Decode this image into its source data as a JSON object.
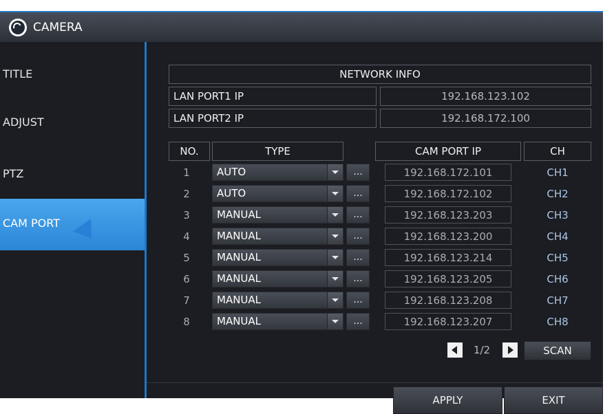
{
  "window": {
    "title": "CAMERA"
  },
  "sidebar": {
    "items": [
      {
        "label": "TITLE",
        "active": false
      },
      {
        "label": "ADJUST",
        "active": false
      },
      {
        "label": "PTZ",
        "active": false
      },
      {
        "label": "CAM PORT",
        "active": true
      }
    ]
  },
  "network": {
    "header": "NETWORK INFO",
    "lan1_label": "LAN PORT1 IP",
    "lan1_value": "192.168.123.102",
    "lan2_label": "LAN PORT2 IP",
    "lan2_value": "192.168.172.100"
  },
  "table": {
    "headers": {
      "no": "NO.",
      "type": "TYPE",
      "ip": "CAM PORT IP",
      "ch": "CH"
    },
    "rows": [
      {
        "no": "1",
        "type": "AUTO",
        "dots": "...",
        "ip": "192.168.172.101",
        "ch": "CH1"
      },
      {
        "no": "2",
        "type": "AUTO",
        "dots": "...",
        "ip": "192.168.172.102",
        "ch": "CH2"
      },
      {
        "no": "3",
        "type": "MANUAL",
        "dots": "...",
        "ip": "192.168.123.203",
        "ch": "CH3"
      },
      {
        "no": "4",
        "type": "MANUAL",
        "dots": "...",
        "ip": "192.168.123.200",
        "ch": "CH4"
      },
      {
        "no": "5",
        "type": "MANUAL",
        "dots": "...",
        "ip": "192.168.123.214",
        "ch": "CH5"
      },
      {
        "no": "6",
        "type": "MANUAL",
        "dots": "...",
        "ip": "192.168.123.205",
        "ch": "CH6"
      },
      {
        "no": "7",
        "type": "MANUAL",
        "dots": "...",
        "ip": "192.168.123.208",
        "ch": "CH7"
      },
      {
        "no": "8",
        "type": "MANUAL",
        "dots": "...",
        "ip": "192.168.123.207",
        "ch": "CH8"
      }
    ]
  },
  "pager": {
    "page": "1/2",
    "scan_label": "SCAN"
  },
  "footer": {
    "apply_label": "APPLY",
    "exit_label": "EXIT"
  },
  "colors": {
    "accent": "#1f77c8",
    "active_item": "#3a96e0",
    "background": "#1b1d22"
  },
  "icons": {
    "title_logo": "swirl-logo-icon",
    "cursor": "mouse-pointer-icon"
  }
}
